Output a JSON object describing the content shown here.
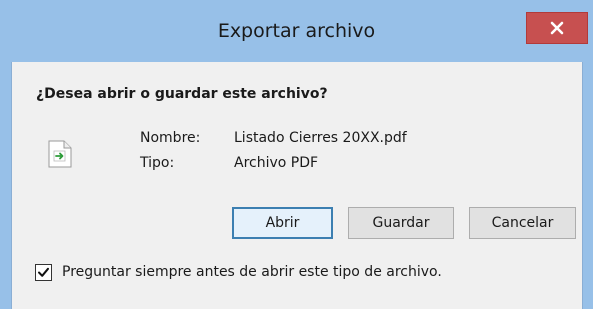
{
  "dialog": {
    "title": "Exportar archivo",
    "question": "¿Desea abrir o guardar este archivo?",
    "name_label": "Nombre:",
    "name_value": "Listado Cierres 20XX.pdf",
    "type_label": "Tipo:",
    "type_value": "Archivo PDF",
    "buttons": {
      "open": "Abrir",
      "save": "Guardar",
      "cancel": "Cancelar"
    },
    "checkbox": {
      "label": "Preguntar siempre antes de abrir este tipo de archivo.",
      "checked": true
    },
    "icons": {
      "close": "close-icon",
      "file": "file-export-icon",
      "check": "checkmark-icon"
    },
    "colors": {
      "titlebar": "#97c0e8",
      "close_button": "#c75050",
      "content_bg": "#f0f0f0",
      "default_button_border": "#3c7fb1"
    }
  }
}
